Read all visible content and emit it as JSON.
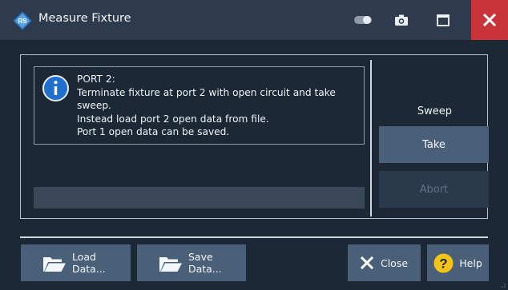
{
  "window": {
    "title": "Measure Fixture",
    "icons": {
      "app": "rohde-schwarz-logo-icon",
      "toggle": "toggle-icon",
      "camera": "camera-icon",
      "maximize": "maximize-icon",
      "close": "close-icon"
    },
    "colors": {
      "background": "#1c2836",
      "titlebar": "#2d3b4c",
      "close_button": "#c9343b",
      "button": "#4a6079",
      "disabled_button": "#2b3a4b",
      "info_icon": "#1f6fd1",
      "help_icon": "#f4c316"
    }
  },
  "info": {
    "icon": "info-icon",
    "lines": [
      "PORT 2:",
      "Terminate fixture at port 2 with open circuit and take",
      "sweep.",
      "Instead load port 2 open data from file.",
      "Port 1 open data can be saved."
    ]
  },
  "progress": {
    "value": 0
  },
  "sweep": {
    "label": "Sweep",
    "take_label": "Take",
    "abort_label": "Abort"
  },
  "footer": {
    "load": {
      "line1": "Load",
      "line2": "Data...",
      "icon": "folder-open-icon"
    },
    "save": {
      "line1": "Save",
      "line2": "Data...",
      "icon": "folder-open-icon"
    },
    "close": {
      "label": "Close",
      "icon": "close-x-icon"
    },
    "help": {
      "label": "Help",
      "icon": "help-icon"
    }
  }
}
